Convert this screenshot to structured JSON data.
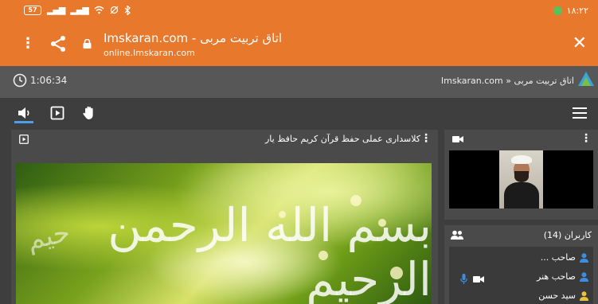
{
  "status_bar": {
    "battery": "57",
    "time": "۱۸:۲۲"
  },
  "browser": {
    "page_title": "Imskaran.com - اتاق تربیت مربی",
    "url": "online.Imskaran.com",
    "close_label": "✕"
  },
  "header": {
    "timer": "1:06:34",
    "breadcrumb": "Imskaran.com » اتاق تربیت مربی"
  },
  "presentation": {
    "title": "کلاسداری عملی حفظ قرآن کریم حافظ یار",
    "slide_calligraphy": "بسم الله الرحمن الرحيم",
    "slide_calligraphy_2": "حيم"
  },
  "users": {
    "title": "کاربران (14)",
    "items": [
      {
        "name": "صاحب ..."
      },
      {
        "name": "صاحب هنر"
      },
      {
        "name": "سید حسن"
      }
    ]
  },
  "colors": {
    "browser_bar": "#e8792c",
    "header_bg": "#575757",
    "app_bg": "#3e3e3e",
    "panel_bg": "#4a4a4a",
    "accent_blue": "#4b9ee8",
    "user_icon_blue": "#3d8ee0",
    "user_icon_yellow": "#e8c23a"
  },
  "icons": [
    "battery-icon",
    "signal-icon",
    "wifi-icon",
    "bluetooth-icon",
    "menu-dots-icon",
    "share-icon",
    "lock-icon",
    "close-icon",
    "clock-icon",
    "logo-icon",
    "speaker-icon",
    "play-icon",
    "hand-icon",
    "hamburger-icon",
    "camera-icon",
    "users-icon",
    "person-icon",
    "mic-icon",
    "video-icon"
  ]
}
